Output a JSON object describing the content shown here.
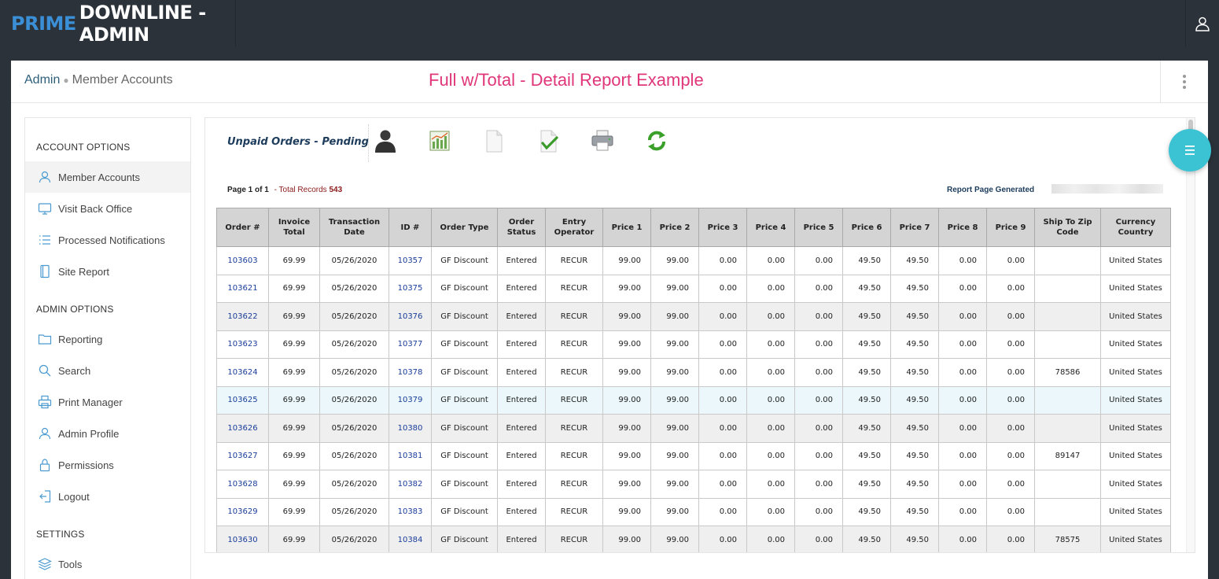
{
  "app": {
    "brand_prefix": "PRIME",
    "brand_suffix": "DOWNLINE - ADMIN"
  },
  "breadcrumb": {
    "root": "Admin",
    "current": "Member Accounts"
  },
  "page_heading": "Full w/Total - Detail Report Example",
  "sidebar": {
    "sections": [
      {
        "title": "ACCOUNT OPTIONS",
        "items": [
          {
            "label": "Member Accounts",
            "icon": "user-icon",
            "active": true
          },
          {
            "label": "Visit Back Office",
            "icon": "monitor-icon"
          },
          {
            "label": "Processed Notifications",
            "icon": "list-icon"
          },
          {
            "label": "Site Report",
            "icon": "document-icon"
          }
        ]
      },
      {
        "title": "ADMIN OPTIONS",
        "items": [
          {
            "label": "Reporting",
            "icon": "folder-icon"
          },
          {
            "label": "Search",
            "icon": "search-icon"
          },
          {
            "label": "Print Manager",
            "icon": "printer-icon"
          },
          {
            "label": "Admin Profile",
            "icon": "user-icon"
          },
          {
            "label": "Permissions",
            "icon": "lock-icon"
          },
          {
            "label": "Logout",
            "icon": "logout-icon"
          }
        ]
      },
      {
        "title": "SETTINGS",
        "items": [
          {
            "label": "Tools",
            "icon": "layers-icon"
          }
        ]
      }
    ]
  },
  "report": {
    "title": "Unpaid Orders - Pending",
    "toolbar_icons": [
      "person-icon",
      "chart-icon",
      "blank-page-icon",
      "checked-page-icon",
      "printer-icon",
      "refresh-icon"
    ],
    "page_label": "Page 1 of 1",
    "total_label": "- Total Records",
    "total_value": "543",
    "generated_label": "Report Page Generated",
    "columns": [
      "Order #",
      "Invoice Total",
      "Transaction Date",
      "ID #",
      "Order Type",
      "Order Status",
      "Entry Operator",
      "Price 1",
      "Price 2",
      "Price 3",
      "Price 4",
      "Price 5",
      "Price 6",
      "Price 7",
      "Price 8",
      "Price 9",
      "Ship To Zip Code",
      "Currency Country"
    ],
    "rows": [
      [
        "103603",
        "69.99",
        "05/26/2020",
        "10357",
        "GF Discount",
        "Entered",
        "RECUR",
        "99.00",
        "99.00",
        "0.00",
        "0.00",
        "0.00",
        "49.50",
        "49.50",
        "0.00",
        "0.00",
        "",
        "United States"
      ],
      [
        "103621",
        "69.99",
        "05/26/2020",
        "10375",
        "GF Discount",
        "Entered",
        "RECUR",
        "99.00",
        "99.00",
        "0.00",
        "0.00",
        "0.00",
        "49.50",
        "49.50",
        "0.00",
        "0.00",
        "",
        "United States"
      ],
      [
        "103622",
        "69.99",
        "05/26/2020",
        "10376",
        "GF Discount",
        "Entered",
        "RECUR",
        "99.00",
        "99.00",
        "0.00",
        "0.00",
        "0.00",
        "49.50",
        "49.50",
        "0.00",
        "0.00",
        "",
        "United States"
      ],
      [
        "103623",
        "69.99",
        "05/26/2020",
        "10377",
        "GF Discount",
        "Entered",
        "RECUR",
        "99.00",
        "99.00",
        "0.00",
        "0.00",
        "0.00",
        "49.50",
        "49.50",
        "0.00",
        "0.00",
        "",
        "United States"
      ],
      [
        "103624",
        "69.99",
        "05/26/2020",
        "10378",
        "GF Discount",
        "Entered",
        "RECUR",
        "99.00",
        "99.00",
        "0.00",
        "0.00",
        "0.00",
        "49.50",
        "49.50",
        "0.00",
        "0.00",
        "78586",
        "United States"
      ],
      [
        "103625",
        "69.99",
        "05/26/2020",
        "10379",
        "GF Discount",
        "Entered",
        "RECUR",
        "99.00",
        "99.00",
        "0.00",
        "0.00",
        "0.00",
        "49.50",
        "49.50",
        "0.00",
        "0.00",
        "",
        "United States"
      ],
      [
        "103626",
        "69.99",
        "05/26/2020",
        "10380",
        "GF Discount",
        "Entered",
        "RECUR",
        "99.00",
        "99.00",
        "0.00",
        "0.00",
        "0.00",
        "49.50",
        "49.50",
        "0.00",
        "0.00",
        "",
        "United States"
      ],
      [
        "103627",
        "69.99",
        "05/26/2020",
        "10381",
        "GF Discount",
        "Entered",
        "RECUR",
        "99.00",
        "99.00",
        "0.00",
        "0.00",
        "0.00",
        "49.50",
        "49.50",
        "0.00",
        "0.00",
        "89147",
        "United States"
      ],
      [
        "103628",
        "69.99",
        "05/26/2020",
        "10382",
        "GF Discount",
        "Entered",
        "RECUR",
        "99.00",
        "99.00",
        "0.00",
        "0.00",
        "0.00",
        "49.50",
        "49.50",
        "0.00",
        "0.00",
        "",
        "United States"
      ],
      [
        "103629",
        "69.99",
        "05/26/2020",
        "10383",
        "GF Discount",
        "Entered",
        "RECUR",
        "99.00",
        "99.00",
        "0.00",
        "0.00",
        "0.00",
        "49.50",
        "49.50",
        "0.00",
        "0.00",
        "",
        "United States"
      ],
      [
        "103630",
        "69.99",
        "05/26/2020",
        "10384",
        "GF Discount",
        "Entered",
        "RECUR",
        "99.00",
        "99.00",
        "0.00",
        "0.00",
        "0.00",
        "49.50",
        "49.50",
        "0.00",
        "0.00",
        "78575",
        "United States"
      ]
    ]
  },
  "colors": {
    "brand_blue": "#3a8fd6",
    "heading_pink": "#e0367a",
    "link_blue": "#1a3d99",
    "fab_teal": "#3cc3d3",
    "topbar": "#2b323a"
  }
}
